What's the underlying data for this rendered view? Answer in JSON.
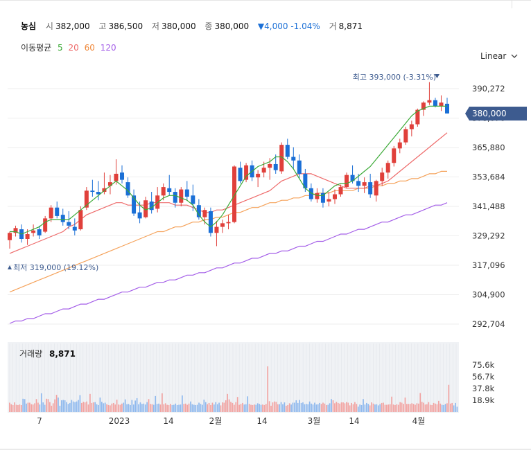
{
  "header": {
    "name": "농심",
    "open_label": "시",
    "open": "382,000",
    "high_label": "고",
    "high": "386,500",
    "low_label": "저",
    "low": "380,000",
    "close_label": "종",
    "close": "380,000",
    "change": "▼4,000 -1.04%",
    "volume_label": "거",
    "volume": "8,871"
  },
  "ma_legend": {
    "title": "이동평균",
    "p5": "5",
    "p20": "20",
    "p60": "60",
    "p120": "120"
  },
  "scale_toggle": {
    "label": "Linear"
  },
  "colors": {
    "up": "#e0403b",
    "down": "#1a6fd6",
    "ma5": "#3aa935",
    "ma20": "#ee6a6a",
    "ma60": "#f5a25a",
    "ma120": "#a45ee8",
    "badge": "#3d5b8f"
  },
  "chart_data": {
    "type": "candlestick",
    "price_axis": {
      "ticks": [
        "390,272",
        "378,076",
        "365,880",
        "353,684",
        "341,488",
        "329,292",
        "317,096",
        "304,900",
        "292,704"
      ],
      "ylim": [
        292704,
        390272
      ]
    },
    "current_price_label": "380,000",
    "max_annotation": "최고 393,000 (-3.31%)",
    "min_annotation": "최저 319,000 (19.12%)",
    "x_labels": [
      "7",
      "2023",
      "14",
      "2월",
      "14",
      "3월",
      "14",
      "4월"
    ],
    "candles": [
      [
        327500,
        331000,
        324000,
        330500
      ],
      [
        330500,
        333500,
        329000,
        332500
      ],
      [
        332000,
        334000,
        326500,
        328000
      ],
      [
        328000,
        332000,
        325500,
        330000
      ],
      [
        330500,
        334000,
        329000,
        331500
      ],
      [
        332000,
        333500,
        328000,
        329500
      ],
      [
        331000,
        337500,
        330500,
        336500
      ],
      [
        336500,
        342000,
        335000,
        341000
      ],
      [
        341000,
        343500,
        336500,
        337500
      ],
      [
        338000,
        340500,
        333500,
        335000
      ],
      [
        335000,
        339500,
        332000,
        333500
      ],
      [
        333000,
        336500,
        329500,
        331500
      ],
      [
        332000,
        341500,
        331500,
        340000
      ],
      [
        341000,
        349500,
        340000,
        348000
      ],
      [
        348000,
        352500,
        345500,
        347500
      ],
      [
        347500,
        352000,
        344000,
        346500
      ],
      [
        347500,
        355500,
        346500,
        349000
      ],
      [
        350000,
        354500,
        346500,
        351500
      ],
      [
        352000,
        361000,
        350500,
        355000
      ],
      [
        355500,
        358500,
        351000,
        352500
      ],
      [
        351500,
        353500,
        345000,
        346000
      ],
      [
        346000,
        348500,
        337500,
        338500
      ],
      [
        339000,
        343500,
        334500,
        336500
      ],
      [
        337000,
        345500,
        336500,
        344000
      ],
      [
        343500,
        347500,
        338500,
        340000
      ],
      [
        340500,
        349500,
        339000,
        346000
      ],
      [
        346000,
        351000,
        344000,
        349500
      ],
      [
        349000,
        354500,
        346000,
        347500
      ],
      [
        347500,
        349000,
        341000,
        343000
      ],
      [
        343000,
        349500,
        341500,
        348500
      ],
      [
        348500,
        352000,
        344000,
        345500
      ],
      [
        346000,
        350500,
        339500,
        342500
      ],
      [
        342000,
        344500,
        336000,
        337000
      ],
      [
        337000,
        341000,
        334000,
        340000
      ],
      [
        339500,
        341000,
        329000,
        330500
      ],
      [
        330500,
        335500,
        325000,
        333000
      ],
      [
        333000,
        336000,
        330500,
        334500
      ],
      [
        334500,
        338000,
        332000,
        335000
      ],
      [
        335000,
        358500,
        334500,
        358000
      ],
      [
        357500,
        360000,
        351000,
        352000
      ],
      [
        352500,
        359500,
        351500,
        358500
      ],
      [
        358500,
        360500,
        352000,
        353500
      ],
      [
        353500,
        356500,
        349500,
        355000
      ],
      [
        355500,
        360000,
        353500,
        357500
      ],
      [
        357500,
        361500,
        352500,
        359000
      ],
      [
        359000,
        363000,
        355000,
        356500
      ],
      [
        356000,
        368000,
        355000,
        367000
      ],
      [
        367000,
        369500,
        361000,
        362000
      ],
      [
        362000,
        366000,
        357000,
        360500
      ],
      [
        360500,
        363000,
        353000,
        355000
      ],
      [
        355000,
        357000,
        347500,
        349000
      ],
      [
        349000,
        351000,
        343500,
        344500
      ],
      [
        344500,
        349000,
        343000,
        347000
      ],
      [
        347000,
        349000,
        341000,
        343000
      ],
      [
        343500,
        347500,
        341500,
        344500
      ],
      [
        344500,
        348500,
        342500,
        346500
      ],
      [
        346500,
        350500,
        345500,
        349500
      ],
      [
        349500,
        355500,
        349000,
        354500
      ],
      [
        354500,
        358500,
        351000,
        352000
      ],
      [
        352000,
        355000,
        347500,
        350000
      ],
      [
        350000,
        353500,
        347000,
        351500
      ],
      [
        351500,
        355000,
        345000,
        346500
      ],
      [
        346000,
        352500,
        343500,
        352000
      ],
      [
        352000,
        357500,
        350000,
        355500
      ],
      [
        355500,
        360500,
        353000,
        359500
      ],
      [
        359500,
        366500,
        358000,
        365500
      ],
      [
        365500,
        369500,
        363500,
        368000
      ],
      [
        368000,
        374500,
        367000,
        373500
      ],
      [
        373500,
        377000,
        370500,
        375500
      ],
      [
        375500,
        382000,
        374500,
        381500
      ],
      [
        381500,
        385000,
        379000,
        384500
      ],
      [
        384500,
        393000,
        383500,
        385500
      ],
      [
        385500,
        386500,
        382500,
        383000
      ],
      [
        383000,
        387500,
        381000,
        384500
      ],
      [
        384000,
        386500,
        380000,
        380000
      ]
    ],
    "ma5": [
      331,
      331,
      330,
      331,
      332,
      333,
      335,
      336,
      336,
      336,
      336,
      338,
      340,
      342,
      344,
      346,
      348,
      350,
      352,
      350,
      348,
      345,
      342,
      340,
      341,
      343,
      345,
      346,
      346,
      345,
      344,
      342,
      338,
      335,
      333,
      335,
      338,
      342,
      346,
      350,
      354,
      356,
      358,
      359,
      360,
      362,
      362,
      360,
      357,
      353,
      349,
      347,
      346,
      346,
      348,
      350,
      351,
      351,
      352,
      354,
      356,
      358,
      361,
      364,
      367,
      370,
      373,
      376,
      379,
      381,
      382,
      383,
      383,
      383,
      383
    ],
    "ma20": [
      322,
      323,
      324,
      325,
      326,
      327,
      328,
      329,
      330,
      331,
      333,
      334,
      336,
      338,
      339,
      340,
      341,
      342,
      343,
      343,
      342,
      342,
      342,
      342,
      343,
      343,
      343,
      343,
      342,
      342,
      342,
      341,
      340,
      339,
      339,
      340,
      340,
      341,
      342,
      343,
      344,
      345,
      346,
      347,
      348,
      350,
      352,
      353,
      354,
      355,
      355,
      355,
      354,
      353,
      352,
      351,
      350,
      349,
      349,
      349,
      349,
      350,
      350,
      351,
      352,
      354,
      356,
      358,
      360,
      362,
      364,
      366,
      368,
      370,
      372
    ],
    "ma60": [
      306,
      307,
      308,
      309,
      310,
      311,
      312,
      313,
      314,
      315,
      316,
      317,
      318,
      319,
      320,
      321,
      322,
      323,
      324,
      325,
      326,
      327,
      328,
      329,
      330,
      331,
      331,
      332,
      333,
      333,
      334,
      335,
      335,
      336,
      336,
      337,
      337,
      338,
      339,
      339,
      340,
      341,
      341,
      342,
      343,
      343,
      344,
      344,
      345,
      345,
      346,
      346,
      347,
      347,
      347,
      348,
      348,
      348,
      348,
      349,
      349,
      349,
      350,
      350,
      351,
      351,
      352,
      352,
      353,
      353,
      354,
      355,
      355,
      356,
      356
    ],
    "ma120": [
      293,
      294,
      294,
      295,
      295,
      296,
      297,
      297,
      298,
      299,
      299,
      300,
      301,
      301,
      302,
      303,
      303,
      304,
      305,
      306,
      306,
      307,
      308,
      308,
      309,
      310,
      310,
      311,
      311,
      312,
      313,
      313,
      314,
      314,
      315,
      316,
      316,
      317,
      318,
      318,
      319,
      320,
      320,
      321,
      322,
      322,
      323,
      323,
      324,
      325,
      325,
      326,
      327,
      327,
      328,
      329,
      330,
      330,
      331,
      332,
      332,
      333,
      334,
      335,
      335,
      336,
      337,
      338,
      338,
      339,
      340,
      341,
      342,
      342,
      343
    ],
    "volume_panel": {
      "title": "거래량",
      "current": "8,871",
      "ticks": [
        "75.6k",
        "56.7k",
        "37.8k",
        "18.9k"
      ],
      "ylim": [
        0,
        90000
      ],
      "values": [
        15500,
        13000,
        11500,
        16000,
        12000,
        11500,
        12500,
        11500,
        22000,
        21500,
        14000,
        15500,
        15500,
        13000,
        12500,
        14500,
        21500,
        15500,
        12500,
        31000,
        16000,
        12000,
        22000,
        21500,
        16500,
        10500,
        14500,
        21000,
        28500,
        24000,
        10500,
        19500,
        20000,
        19500,
        16500,
        13500,
        15000,
        20000,
        17500,
        16500,
        17500,
        20000,
        28000,
        15000,
        17000,
        16000,
        17500,
        12500,
        30000,
        15000,
        16000,
        16500,
        13000,
        11500,
        24000,
        17000,
        14500,
        15500,
        13000,
        11500,
        11000,
        14000,
        15000,
        12500,
        20500,
        12500,
        12000,
        14000,
        15500,
        21000,
        13000,
        13500,
        11500,
        20000,
        12500,
        19000,
        23000,
        13000,
        16000,
        13500,
        14000,
        12500,
        16500,
        21500,
        13500,
        13000,
        12000,
        26500,
        13500,
        14000,
        12500,
        31000,
        13000,
        14500,
        12000,
        11500,
        13500,
        11500,
        12000,
        14000,
        11500,
        12000,
        12500,
        27500,
        13500,
        14000,
        12000,
        14000,
        17500,
        13000,
        12000,
        11500,
        12000,
        15500,
        13500,
        12000,
        20500,
        16500,
        13000,
        15000,
        11500,
        15500,
        12500,
        16500,
        13000,
        15500,
        11000,
        16000,
        15500,
        19500,
        30000,
        21000,
        17000,
        15000,
        12000,
        16500,
        25000,
        12000,
        13500,
        15000,
        12500,
        13000,
        26000,
        13500,
        12000,
        11500,
        12500,
        12000,
        14500,
        13500,
        12000,
        12500,
        11500,
        13500,
        75600,
        18000,
        10500,
        16000,
        17500,
        17000,
        13000,
        13000,
        16500,
        13000,
        16000,
        10500,
        11500,
        14500,
        12500,
        15500,
        15500,
        19500,
        15000,
        20000,
        15000,
        16000,
        13000,
        13500,
        13000,
        17500,
        14000,
        12500,
        15500,
        12500,
        13000,
        15000,
        13500,
        15500,
        14000,
        11500,
        12000,
        14500,
        21500,
        19500,
        14500,
        17000,
        15000,
        14000,
        16000,
        16000,
        14500,
        16500,
        15500,
        11000,
        15000,
        13000,
        16500,
        13500,
        9000,
        12500,
        11500,
        21500,
        12500,
        15000,
        13500,
        11000,
        16000,
        14000,
        12500,
        13000,
        11000,
        13000,
        15000,
        15500,
        12000,
        12000,
        12500,
        13000,
        25500,
        12500,
        11500,
        13000,
        12000,
        16500,
        15500,
        13500,
        24000,
        13500,
        13500,
        13500,
        14500,
        13500,
        12000,
        14500,
        14000,
        31500,
        17000,
        15500,
        12500,
        13000,
        16500,
        12000,
        11500,
        15000,
        14000,
        13000,
        18500,
        14000,
        12000,
        11500,
        13500,
        14500,
        45000,
        14000,
        15000,
        11000,
        15000,
        8871
      ]
    }
  }
}
